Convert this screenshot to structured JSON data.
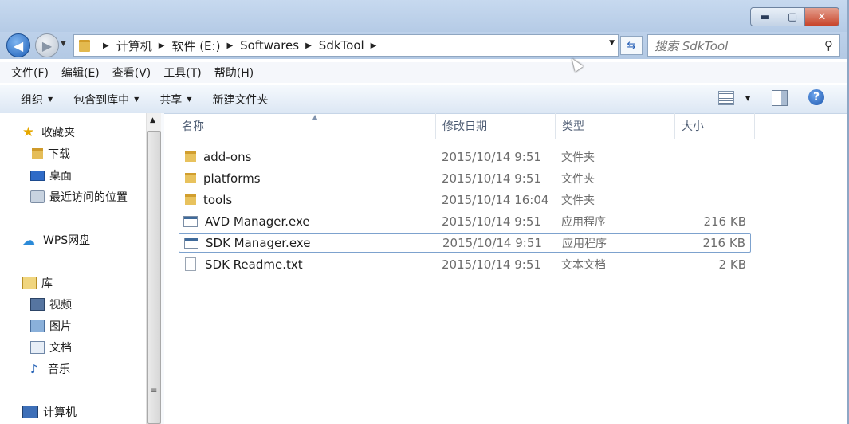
{
  "window": {
    "controls": {
      "minimize": "▬",
      "maximize": "▢",
      "close": "✕"
    }
  },
  "address": {
    "crumbs": [
      "计算机",
      "软件 (E:)",
      "Softwares",
      "SdkTool"
    ],
    "search_placeholder": "搜索 SdkTool"
  },
  "menu": [
    "文件(F)",
    "编辑(E)",
    "查看(V)",
    "工具(T)",
    "帮助(H)"
  ],
  "toolbar": {
    "organize": "组织",
    "include_in_library": "包含到库中",
    "share": "共享",
    "new_folder": "新建文件夹"
  },
  "nav": {
    "favorites": "收藏夹",
    "downloads": "下载",
    "desktop": "桌面",
    "recent": "最近访问的位置",
    "wps": "WPS网盘",
    "libraries": "库",
    "videos": "视频",
    "pictures": "图片",
    "documents": "文档",
    "music": "音乐",
    "computer": "计算机"
  },
  "columns": {
    "name": "名称",
    "date": "修改日期",
    "type": "类型",
    "size": "大小"
  },
  "files": [
    {
      "name": "add-ons",
      "date": "2015/10/14 9:51",
      "type": "文件夹",
      "size": "",
      "icon": "folder-icon"
    },
    {
      "name": "platforms",
      "date": "2015/10/14 9:51",
      "type": "文件夹",
      "size": "",
      "icon": "folder-icon"
    },
    {
      "name": "tools",
      "date": "2015/10/14 16:04",
      "type": "文件夹",
      "size": "",
      "icon": "folder-icon"
    },
    {
      "name": "AVD Manager.exe",
      "date": "2015/10/14 9:51",
      "type": "应用程序",
      "size": "216 KB",
      "icon": "exe-icon"
    },
    {
      "name": "SDK Manager.exe",
      "date": "2015/10/14 9:51",
      "type": "应用程序",
      "size": "216 KB",
      "icon": "exe-icon",
      "selected": true
    },
    {
      "name": "SDK Readme.txt",
      "date": "2015/10/14 9:51",
      "type": "文本文档",
      "size": "2 KB",
      "icon": "text-file-icon"
    }
  ]
}
